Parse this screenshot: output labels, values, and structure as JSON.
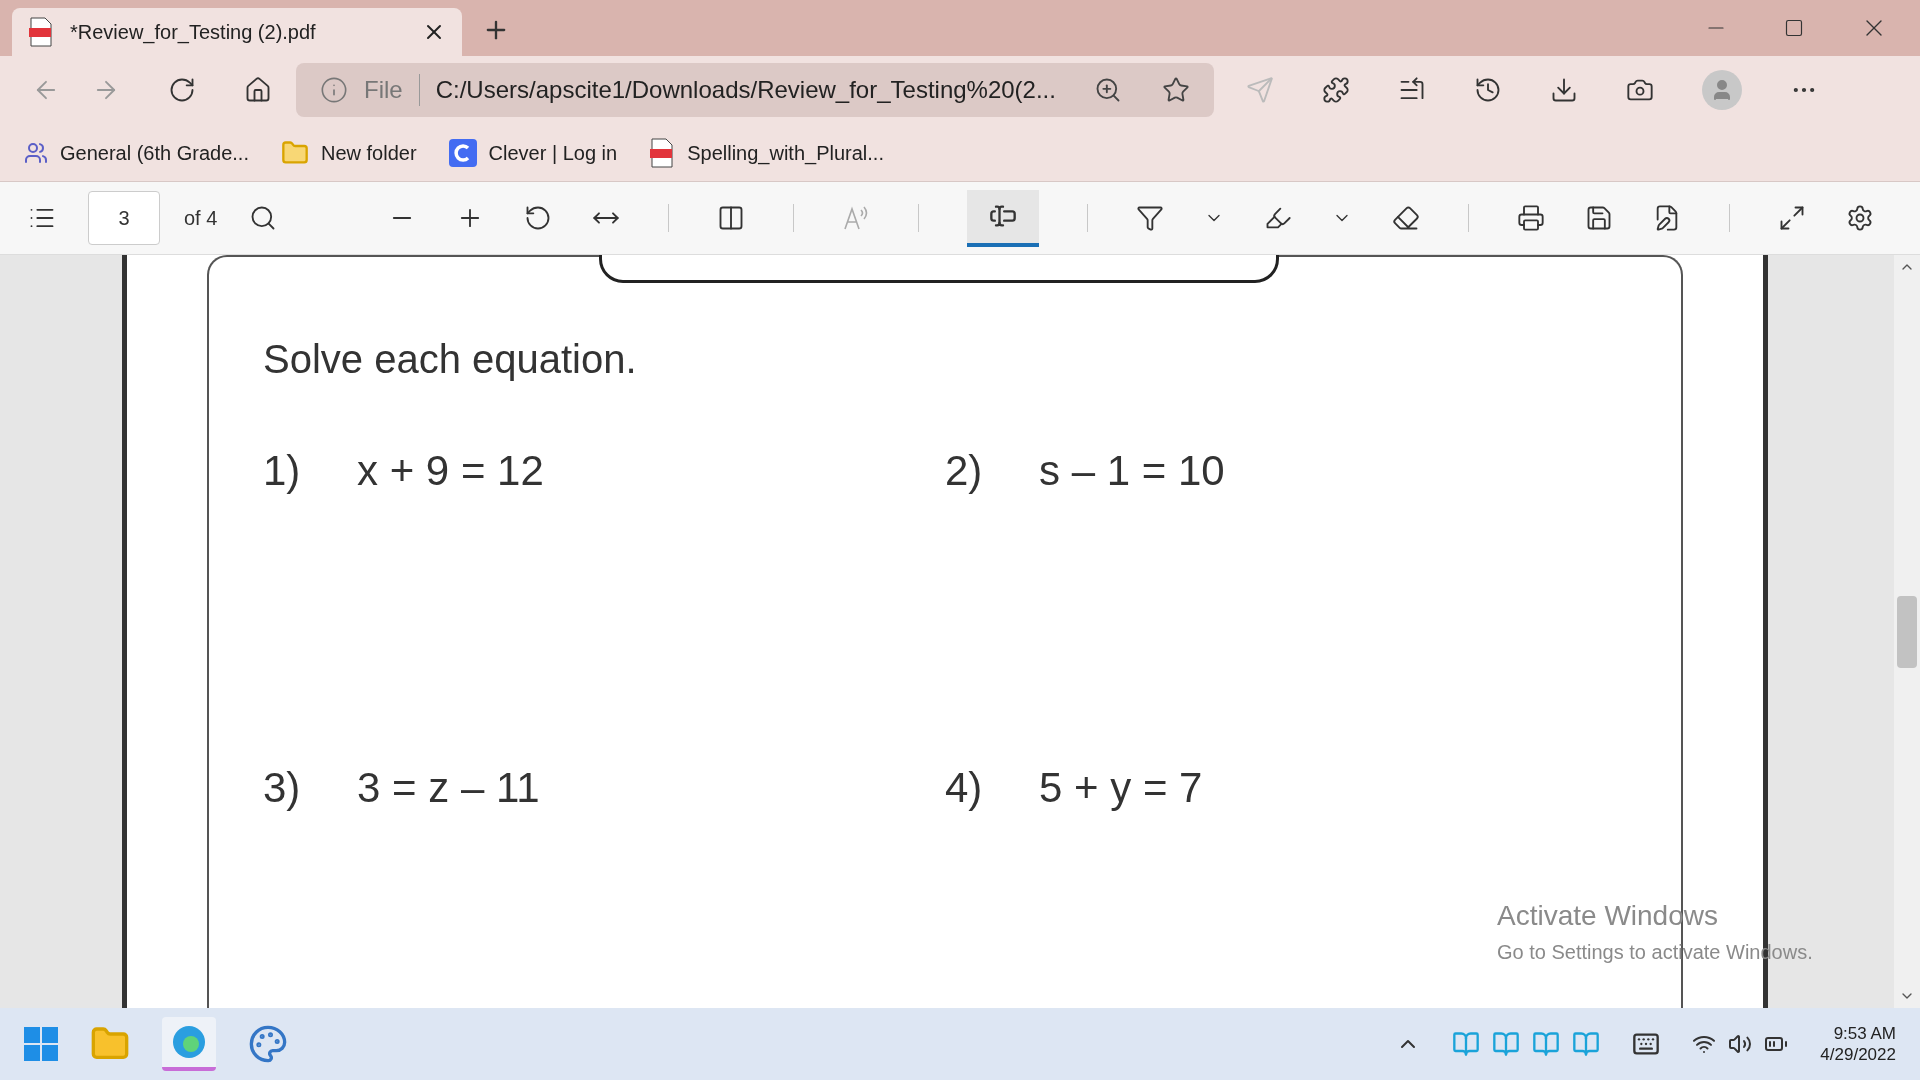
{
  "tab": {
    "title": "*Review_for_Testing (2).pdf",
    "selected": true
  },
  "address": {
    "scheme": "File",
    "url": "C:/Users/apscite1/Downloads/Review_for_Testing%20(2..."
  },
  "bookmarks": [
    {
      "label": "General (6th Grade...",
      "kind": "teams"
    },
    {
      "label": "New folder",
      "kind": "folder"
    },
    {
      "label": "Clever | Log in",
      "kind": "clever"
    },
    {
      "label": "Spelling_with_Plural...",
      "kind": "pdf"
    }
  ],
  "pdf_toolbar": {
    "page": "3",
    "page_count": "of 4",
    "text_tool_selected": true
  },
  "document": {
    "instruction": "Solve each equation.",
    "problems": [
      {
        "number": "1)",
        "equation": "x + 9 = 12"
      },
      {
        "number": "2)",
        "equation": "s – 1 = 10"
      },
      {
        "number": "3)",
        "equation": "3 = z – 11"
      },
      {
        "number": "4)",
        "equation": "5 + y = 7"
      }
    ]
  },
  "activation_notice": {
    "title": "Activate Windows",
    "message": "Go to Settings to activate Windows."
  },
  "taskbar": {
    "time": "9:53 AM",
    "date": "4/29/2022"
  }
}
